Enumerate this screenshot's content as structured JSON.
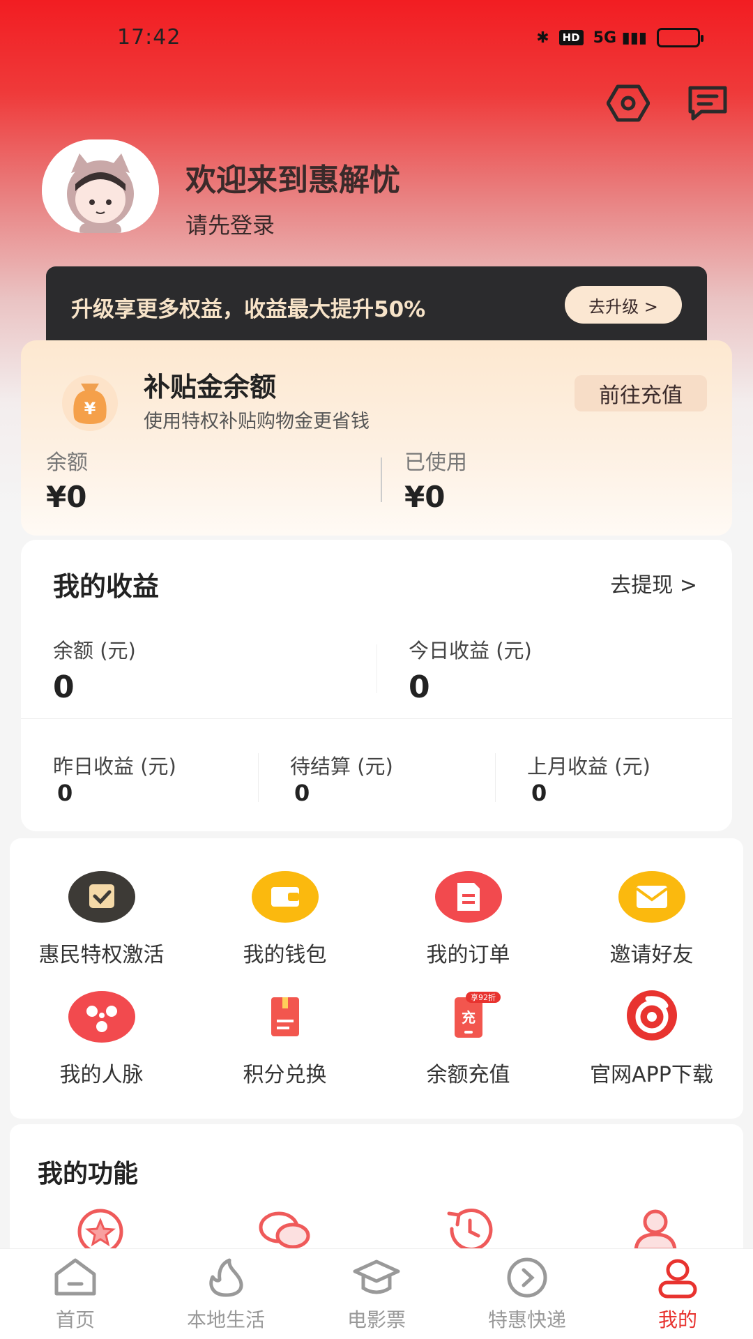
{
  "status_bar": {
    "time": "17:42",
    "network": "5G",
    "hd": "HD"
  },
  "header_icons": [
    "settings-hex-icon",
    "message-icon"
  ],
  "profile": {
    "welcome": "欢迎来到惠解忧",
    "login_tip": "请先登录"
  },
  "upgrade_banner": {
    "text": "升级享更多权益，收益最大提升50%",
    "button": "去升级 >"
  },
  "subsidy": {
    "title": "补贴金余额",
    "desc": "使用特权补贴购物金更省钱",
    "button": "前往充值",
    "balance_label": "余额",
    "balance_value": "¥0",
    "used_label": "已使用",
    "used_value": "¥0"
  },
  "earnings": {
    "title": "我的收益",
    "withdraw": "去提现 >",
    "balance_label": "余额 (元)",
    "balance_value": "0",
    "today_label": "今日收益 (元)",
    "today_value": "0",
    "yesterday_label": "昨日收益 (元)",
    "yesterday_value": "0",
    "pending_label": "待结算 (元)",
    "pending_value": "0",
    "last_month_label": "上月收益 (元)",
    "last_month_value": "0"
  },
  "grid": [
    {
      "label": "惠民特权激活",
      "icon": "calendar-check-icon"
    },
    {
      "label": "我的钱包",
      "icon": "wallet-icon"
    },
    {
      "label": "我的订单",
      "icon": "order-icon"
    },
    {
      "label": "邀请好友",
      "icon": "envelope-icon"
    },
    {
      "label": "我的人脉",
      "icon": "network-icon"
    },
    {
      "label": "积分兑换",
      "icon": "points-icon"
    },
    {
      "label": "余额充值",
      "icon": "recharge-icon",
      "badge": "享92折",
      "glyph": "充"
    },
    {
      "label": "官网APP下载",
      "icon": "app-logo-icon"
    }
  ],
  "features": {
    "title": "我的功能",
    "icons": [
      "star-badge-icon",
      "chat-icon",
      "history-icon",
      "user-service-icon"
    ]
  },
  "tabbar": [
    {
      "label": "首页",
      "icon": "home-icon"
    },
    {
      "label": "本地生活",
      "icon": "flame-icon"
    },
    {
      "label": "电影票",
      "icon": "graduation-cap-icon"
    },
    {
      "label": "特惠快递",
      "icon": "circle-arrow-icon"
    },
    {
      "label": "我的",
      "icon": "user-icon",
      "active": true
    }
  ],
  "colors": {
    "accent": "#e8332f",
    "banner_dark": "#2b2b2d",
    "gold_text": "#f7e3c8"
  }
}
